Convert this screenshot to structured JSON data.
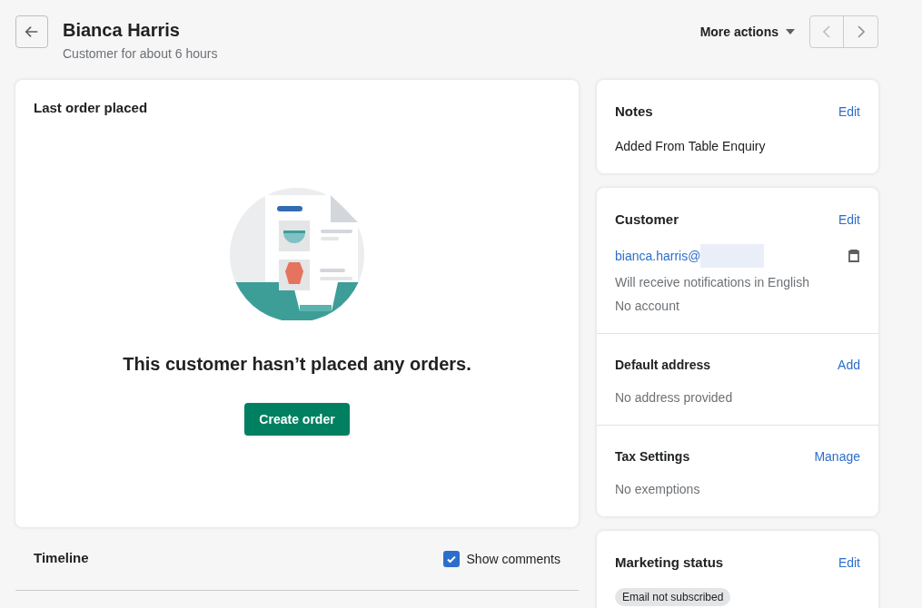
{
  "header": {
    "title": "Bianca Harris",
    "subtitle": "Customer for about 6 hours",
    "more_actions": "More actions"
  },
  "last_order": {
    "title": "Last order placed",
    "empty_message": "This customer hasn’t placed any orders.",
    "button": "Create order"
  },
  "timeline": {
    "title": "Timeline",
    "show_comments": {
      "label": "Show comments",
      "checked": true
    }
  },
  "notes": {
    "title": "Notes",
    "action": "Edit",
    "text": "Added From Table Enquiry"
  },
  "customer": {
    "title": "Customer",
    "action": "Edit",
    "email": "bianca.harris@",
    "lines": [
      "Will receive notifications in English",
      "No account"
    ],
    "sections": [
      {
        "title": "Default address",
        "action": "Add",
        "text": "No address provided"
      },
      {
        "title": "Tax Settings",
        "action": "Manage",
        "text": "No exemptions"
      }
    ]
  },
  "marketing": {
    "title": "Marketing status",
    "action": "Edit",
    "badges": [
      "Email not subscribed"
    ]
  }
}
